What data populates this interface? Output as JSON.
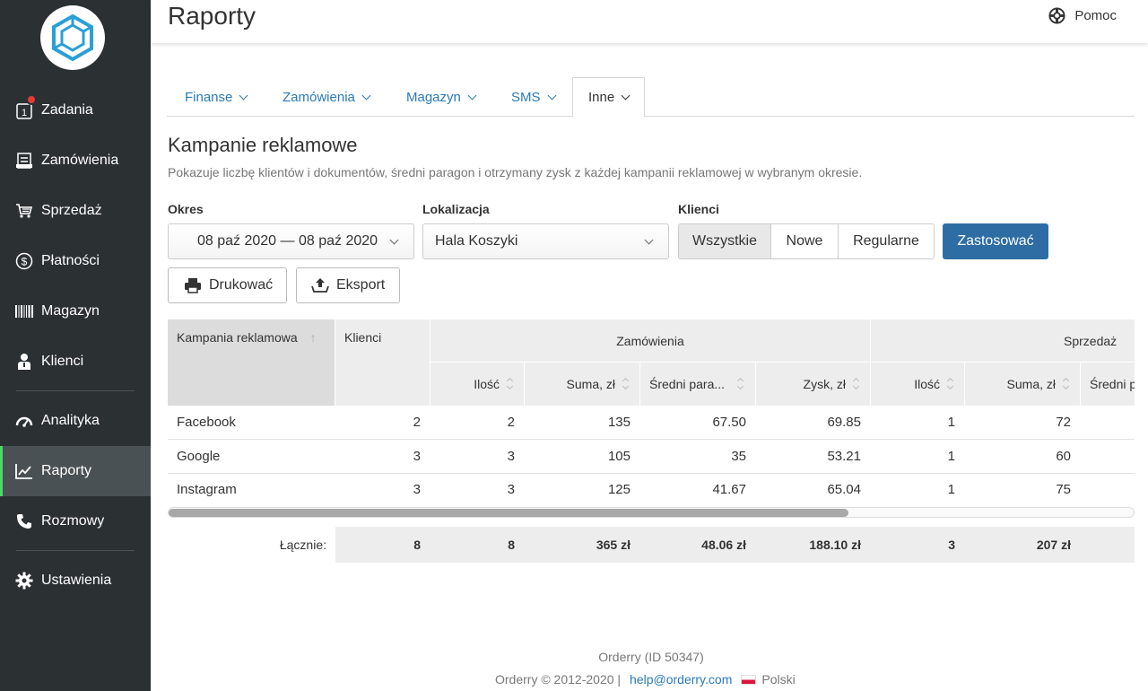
{
  "header": {
    "title": "Raporty",
    "help_label": "Pomoc"
  },
  "sidebar": {
    "items": [
      {
        "label": "Zadania",
        "icon": "tasks-icon"
      },
      {
        "label": "Zamówienia",
        "icon": "orders-icon"
      },
      {
        "label": "Sprzedaż",
        "icon": "cart-icon"
      },
      {
        "label": "Płatności",
        "icon": "dollar-icon"
      },
      {
        "label": "Magazyn",
        "icon": "barcode-icon"
      },
      {
        "label": "Klienci",
        "icon": "user-icon"
      },
      {
        "label": "Analityka",
        "icon": "gauge-icon"
      },
      {
        "label": "Raporty",
        "icon": "chart-icon"
      },
      {
        "label": "Rozmowy",
        "icon": "phone-icon"
      },
      {
        "label": "Ustawienia",
        "icon": "gear-icon"
      }
    ],
    "active": "Raporty",
    "tasks_badge_count": "1"
  },
  "tabs": [
    {
      "label": "Finanse"
    },
    {
      "label": "Zamówienia"
    },
    {
      "label": "Magazyn"
    },
    {
      "label": "SMS"
    },
    {
      "label": "Inne"
    }
  ],
  "report": {
    "title": "Kampanie reklamowe",
    "description": "Pokazuje liczbę klientów i dokumentów, średni paragon i otrzymany zysk z każdej kampanii reklamowej w wybranym okresie."
  },
  "filters": {
    "period_label": "Okres",
    "period_value": "08 paź 2020 — 08 paź 2020",
    "location_label": "Lokalizacja",
    "location_value": "Hala Koszyki",
    "clients_label": "Klienci",
    "clients_options": [
      "Wszystkie",
      "Nowe",
      "Regularne"
    ],
    "clients_selected": "Wszystkie",
    "apply_label": "Zastosować"
  },
  "actions": {
    "print_label": "Drukować",
    "export_label": "Eksport"
  },
  "table": {
    "group_headers": {
      "orders": "Zamówienia",
      "sales": "Sprzedaż"
    },
    "headers": {
      "campaign": "Kampania reklamowa",
      "clients": "Klienci",
      "orders_qty": "Ilość",
      "orders_sum": "Suma, zł",
      "orders_avg": "Średni para...",
      "orders_profit": "Zysk, zł",
      "sales_qty": "Ilość",
      "sales_sum": "Suma, zł",
      "sales_avg": "Średni p"
    },
    "rows": [
      {
        "campaign": "Facebook",
        "clients": "2",
        "orders_qty": "2",
        "orders_sum": "135",
        "orders_avg": "67.50",
        "orders_profit": "69.85",
        "sales_qty": "1",
        "sales_sum": "72"
      },
      {
        "campaign": "Google",
        "clients": "3",
        "orders_qty": "3",
        "orders_sum": "105",
        "orders_avg": "35",
        "orders_profit": "53.21",
        "sales_qty": "1",
        "sales_sum": "60"
      },
      {
        "campaign": "Instagram",
        "clients": "3",
        "orders_qty": "3",
        "orders_sum": "125",
        "orders_avg": "41.67",
        "orders_profit": "65.04",
        "sales_qty": "1",
        "sales_sum": "75"
      }
    ],
    "totals": {
      "label": "Łącznie:",
      "clients": "8",
      "orders_qty": "8",
      "orders_sum": "365 zł",
      "orders_avg": "48.06 zł",
      "orders_profit": "188.10 zł",
      "sales_qty": "3",
      "sales_sum": "207 zł"
    }
  },
  "footer": {
    "line1": "Orderry (ID 50347)",
    "copyright": "Orderry © 2012-2020 |",
    "email": "help@orderry.com",
    "language": "Polski"
  },
  "colors": {
    "sidebar_bg": "#2b3033",
    "active_accent": "#4cd964",
    "primary": "#2e6da4",
    "link": "#2a7ab8",
    "badge": "#e53935"
  }
}
